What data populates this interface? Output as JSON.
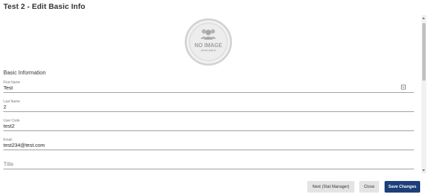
{
  "dialog": {
    "title": "Test 2 - Edit Basic Info"
  },
  "avatar": {
    "text_line1": "NO IMAGE",
    "text_line2": "AVAILABLE"
  },
  "form": {
    "section_label": "Basic Information",
    "fields": {
      "first_name": {
        "label": "First Name",
        "value": "Test",
        "icon": "contact-card-icon"
      },
      "last_name": {
        "label": "Last Name",
        "value": "2"
      },
      "user_code": {
        "label": "User Code",
        "value": "test2"
      },
      "email": {
        "label": "Email",
        "value": "test234@test.com"
      },
      "title": {
        "placeholder": "Title",
        "value": ""
      }
    }
  },
  "actions": {
    "next_label": "Next (Stat Manager)",
    "close_label": "Close",
    "save_label": "Save Changes"
  },
  "colors": {
    "primary": "#1c3f7a",
    "secondary_button": "#e4e4e4"
  }
}
